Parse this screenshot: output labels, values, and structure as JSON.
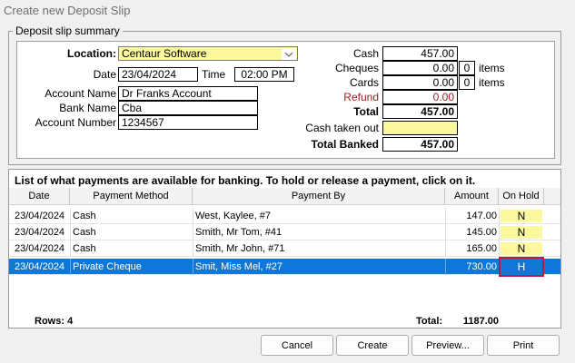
{
  "window": {
    "title": "Create new Deposit Slip"
  },
  "group": {
    "title": "Deposit slip summary"
  },
  "summary": {
    "location_label": "Location:",
    "location_value": "Centaur Software",
    "date_label": "Date",
    "date_value": "23/04/2024",
    "time_label": "Time",
    "time_value": "02:00 PM",
    "account_name_label": "Account Name",
    "account_name_value": "Dr Franks Account",
    "bank_name_label": "Bank Name",
    "bank_name_value": "Cba",
    "account_number_label": "Account Number",
    "account_number_value": "1234567"
  },
  "totals": {
    "cash_label": "Cash",
    "cash_value": "457.00",
    "cheques_label": "Cheques",
    "cheques_value": "0.00",
    "cheques_items": "0",
    "cards_label": "Cards",
    "cards_value": "0.00",
    "cards_items": "0",
    "items_label": "items",
    "refund_label": "Refund",
    "refund_value": "0.00",
    "total_label": "Total",
    "total_value": "457.00",
    "cash_taken_out_label": "Cash taken out",
    "cash_taken_out_value": "",
    "total_banked_label": "Total Banked",
    "total_banked_value": "457.00"
  },
  "list": {
    "caption": "List of what payments are available for banking. To hold or release a payment, click on it.",
    "columns": [
      "Date",
      "Payment Method",
      "Payment By",
      "Amount",
      "On Hold"
    ],
    "rows": [
      {
        "date": "23/04/2024",
        "method": "Cash",
        "by": "West, Kaylee, #7",
        "amount": "147.00",
        "hold": "N"
      },
      {
        "date": "23/04/2024",
        "method": "Cash",
        "by": "Smith, Mr Tom, #41",
        "amount": "145.00",
        "hold": "N"
      },
      {
        "date": "23/04/2024",
        "method": "Cash",
        "by": "Smith, Mr John, #71",
        "amount": "165.00",
        "hold": "N"
      },
      {
        "date": "23/04/2024",
        "method": "Private Cheque",
        "by": "Smit, Miss Mel, #27",
        "amount": "730.00",
        "hold": "H"
      }
    ],
    "rows_label": "Rows:",
    "rows_count": "4",
    "total_label": "Total:",
    "total_value": "1187.00"
  },
  "buttons": {
    "cancel": "Cancel",
    "create": "Create",
    "preview": "Preview...",
    "print": "Print"
  },
  "icons": {
    "dropdown": "chevron-down-icon"
  }
}
